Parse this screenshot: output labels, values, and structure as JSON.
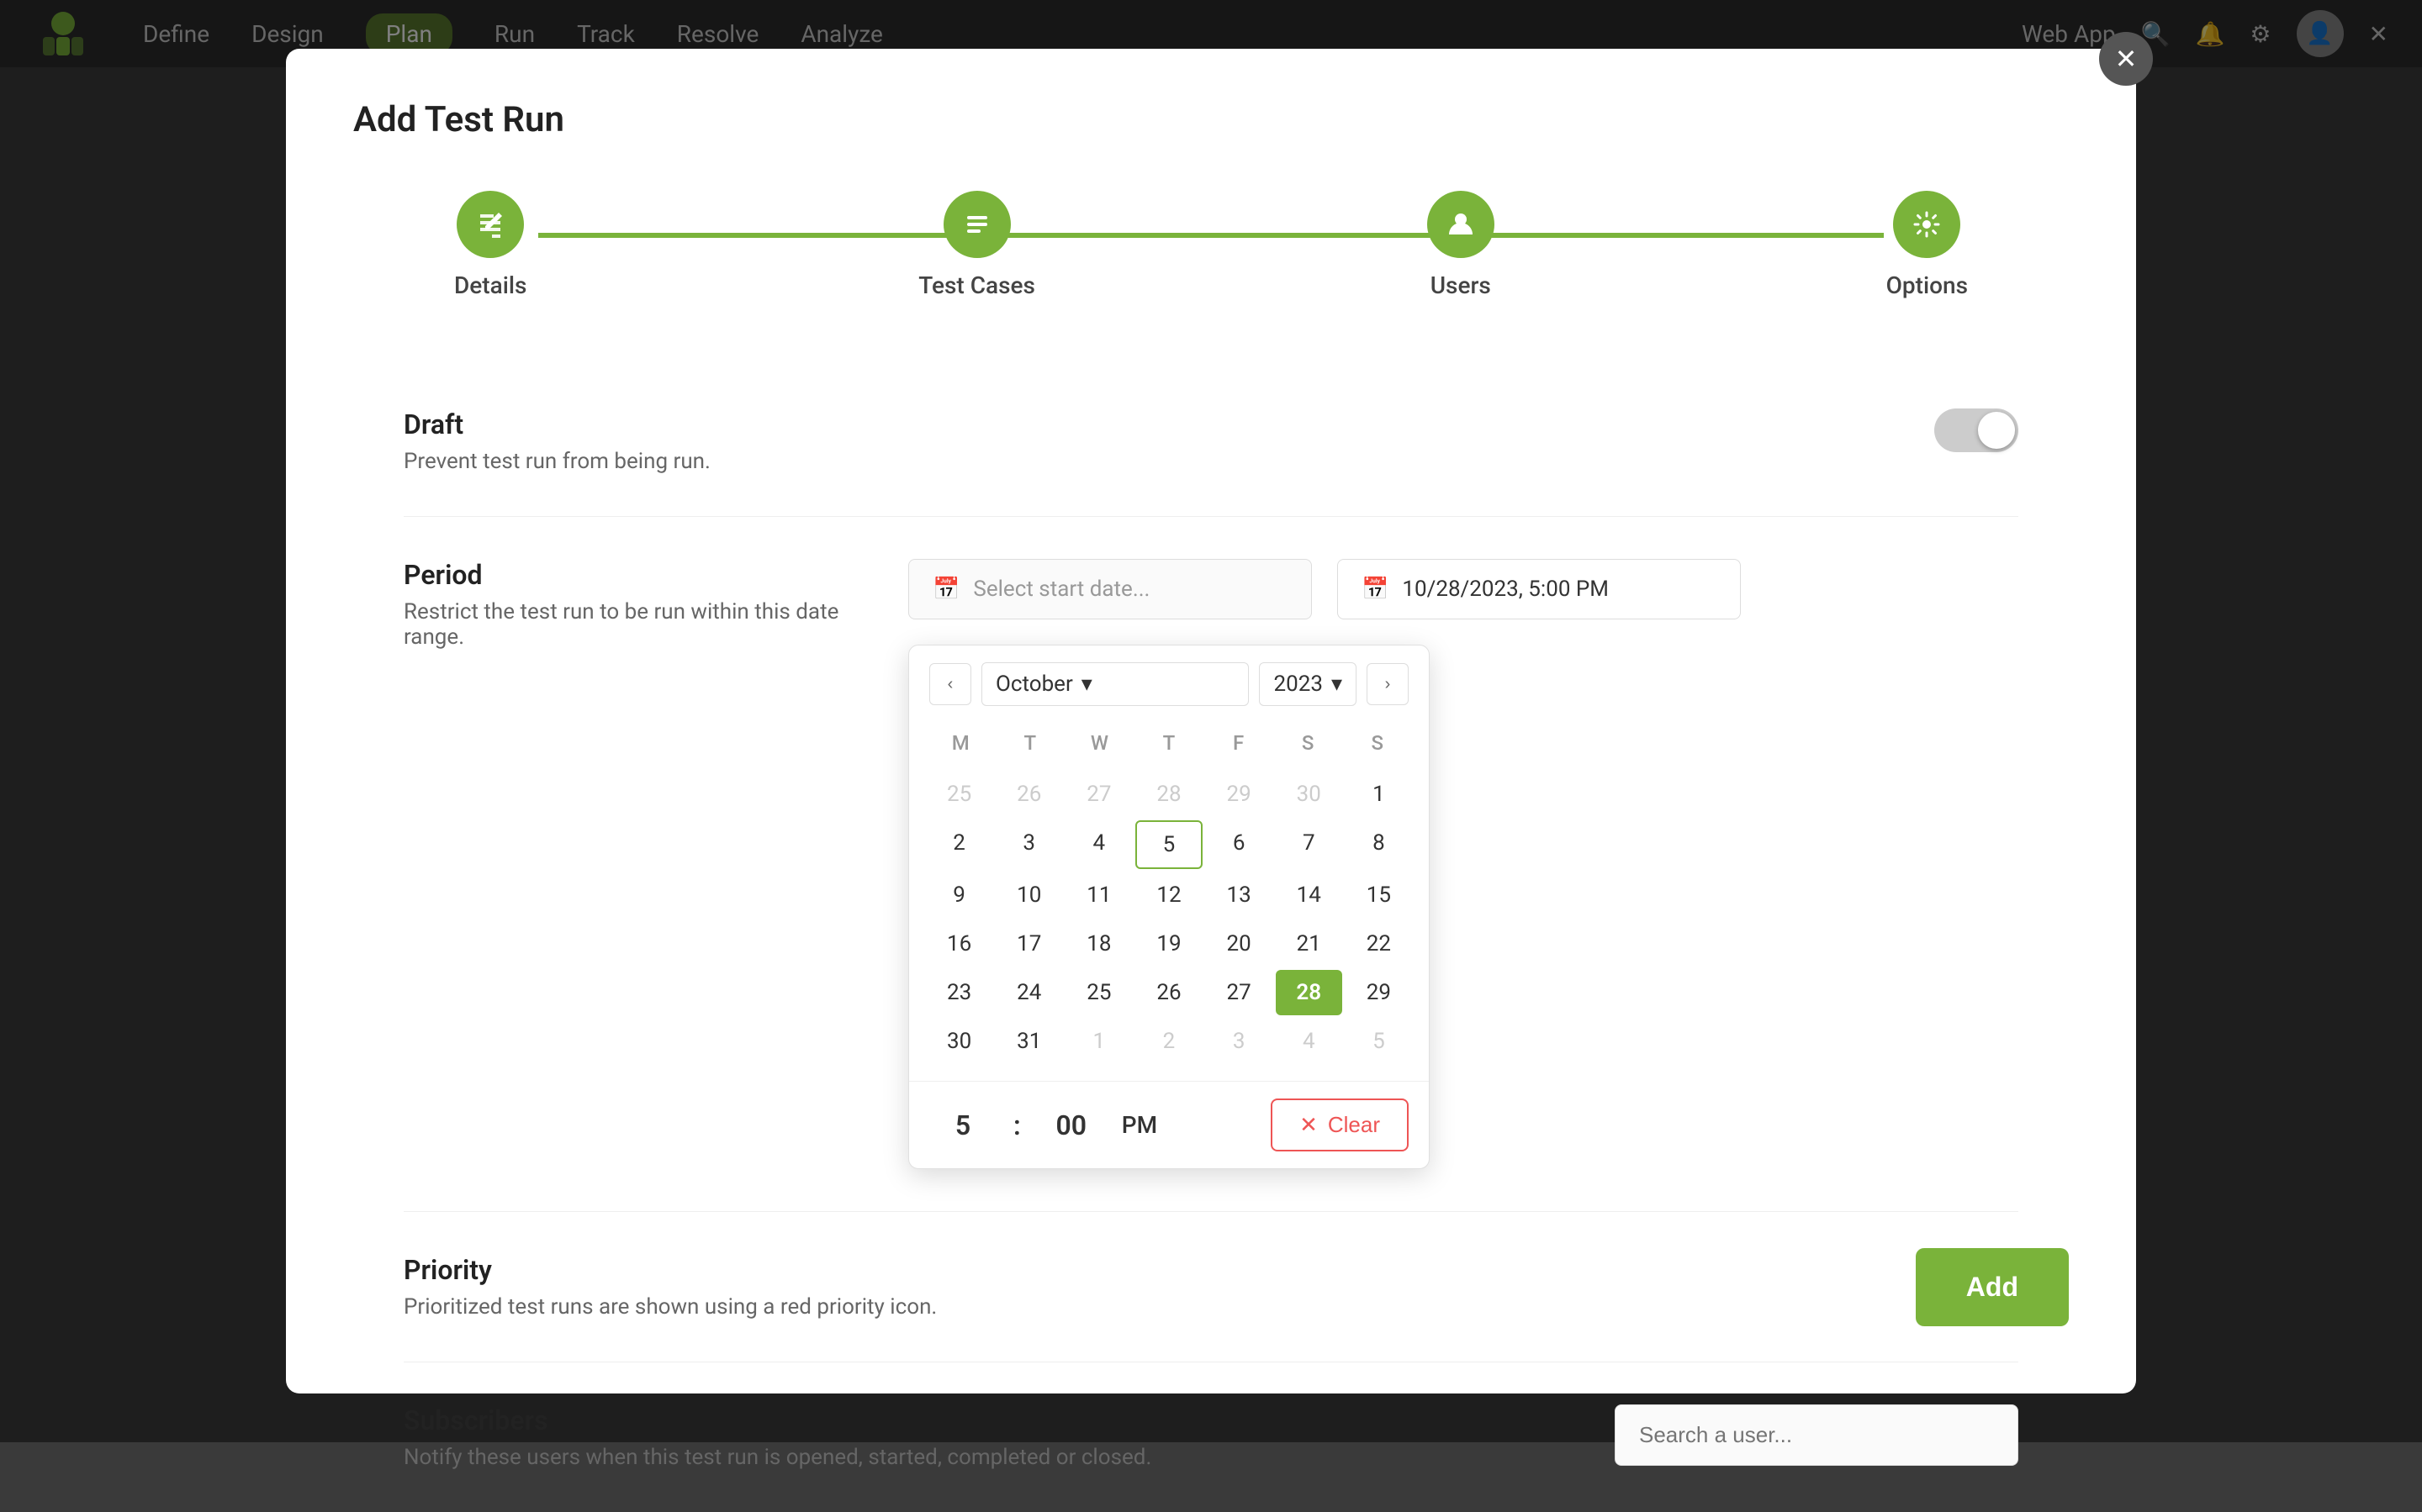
{
  "app": {
    "title": "Web App",
    "close_icon": "✕"
  },
  "nav": {
    "items": [
      {
        "label": "Define",
        "active": false
      },
      {
        "label": "Design",
        "active": false
      },
      {
        "label": "Plan",
        "active": true
      },
      {
        "label": "Run",
        "active": false
      },
      {
        "label": "Track",
        "active": false
      },
      {
        "label": "Resolve",
        "active": false
      },
      {
        "label": "Analyze",
        "active": false
      }
    ]
  },
  "modal": {
    "title": "Add Test Run",
    "close_icon": "✕"
  },
  "stepper": {
    "steps": [
      {
        "label": "Details",
        "icon": "✏"
      },
      {
        "label": "Test Cases",
        "icon": "≡"
      },
      {
        "label": "Users",
        "icon": "👤"
      },
      {
        "label": "Options",
        "icon": "⚙"
      }
    ]
  },
  "draft": {
    "title": "Draft",
    "description": "Prevent test run from being run."
  },
  "period": {
    "title": "Period",
    "description": "Restrict the test run to be run within this date range.",
    "start_placeholder": "Select start date...",
    "end_value": "10/28/2023, 5:00 PM"
  },
  "calendar": {
    "month": "October",
    "year": "2023",
    "day_headers": [
      "M",
      "T",
      "W",
      "T",
      "F",
      "S",
      "S"
    ],
    "weeks": [
      [
        {
          "day": 25,
          "other": true
        },
        {
          "day": 26,
          "other": true
        },
        {
          "day": 27,
          "other": true
        },
        {
          "day": 28,
          "other": true
        },
        {
          "day": 29,
          "other": true
        },
        {
          "day": 30,
          "other": true
        },
        {
          "day": 1,
          "other": false
        }
      ],
      [
        {
          "day": 2,
          "other": false
        },
        {
          "day": 3,
          "other": false
        },
        {
          "day": 4,
          "other": false
        },
        {
          "day": 5,
          "other": false,
          "today": true
        },
        {
          "day": 6,
          "other": false
        },
        {
          "day": 7,
          "other": false
        },
        {
          "day": 8,
          "other": false
        }
      ],
      [
        {
          "day": 9,
          "other": false
        },
        {
          "day": 10,
          "other": false
        },
        {
          "day": 11,
          "other": false
        },
        {
          "day": 12,
          "other": false
        },
        {
          "day": 13,
          "other": false
        },
        {
          "day": 14,
          "other": false
        },
        {
          "day": 15,
          "other": false
        }
      ],
      [
        {
          "day": 16,
          "other": false
        },
        {
          "day": 17,
          "other": false
        },
        {
          "day": 18,
          "other": false
        },
        {
          "day": 19,
          "other": false
        },
        {
          "day": 20,
          "other": false
        },
        {
          "day": 21,
          "other": false
        },
        {
          "day": 22,
          "other": false
        }
      ],
      [
        {
          "day": 23,
          "other": false
        },
        {
          "day": 24,
          "other": false
        },
        {
          "day": 25,
          "other": false
        },
        {
          "day": 26,
          "other": false
        },
        {
          "day": 27,
          "other": false
        },
        {
          "day": 28,
          "other": false,
          "selected": true
        },
        {
          "day": 29,
          "other": false
        }
      ],
      [
        {
          "day": 30,
          "other": false
        },
        {
          "day": 31,
          "other": false
        },
        {
          "day": 1,
          "other": true
        },
        {
          "day": 2,
          "other": true
        },
        {
          "day": 3,
          "other": true
        },
        {
          "day": 4,
          "other": true
        },
        {
          "day": 5,
          "other": true
        }
      ]
    ]
  },
  "time": {
    "hour": "5",
    "minute": "00",
    "period": "PM"
  },
  "clear_button": "Clear",
  "priority": {
    "title": "Priority",
    "description": "Prioritized test runs are shown using a red priority icon."
  },
  "subscribers": {
    "title": "Subscribers",
    "description": "Notify these users when this test run is opened, started, completed or closed.",
    "placeholder": "Search a user..."
  },
  "add_button": "Add"
}
